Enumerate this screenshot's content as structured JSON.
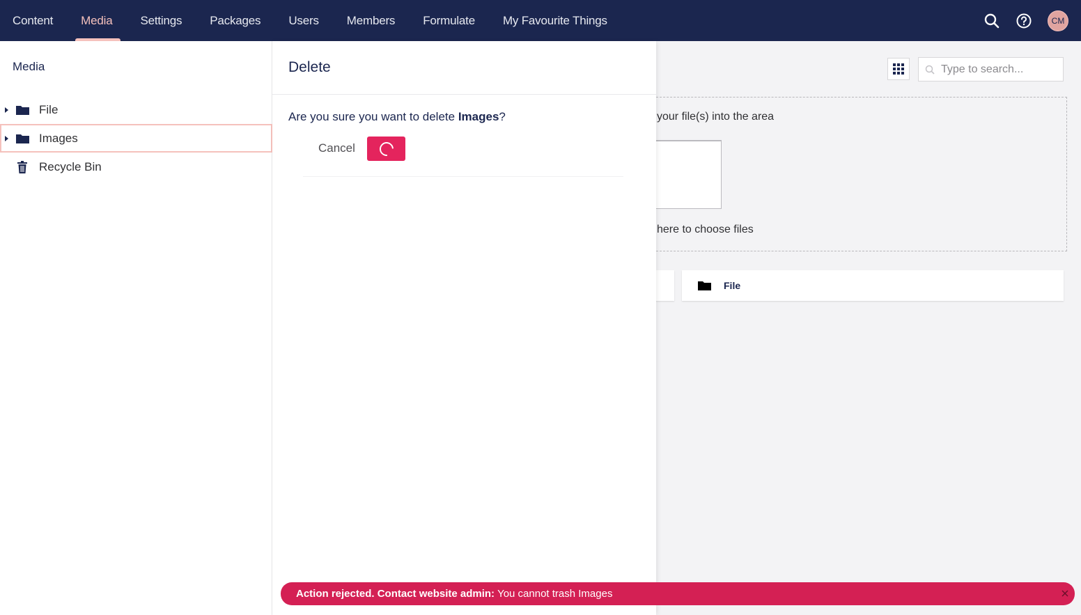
{
  "nav": {
    "items": [
      {
        "label": "Content",
        "active": false
      },
      {
        "label": "Media",
        "active": true
      },
      {
        "label": "Settings",
        "active": false
      },
      {
        "label": "Packages",
        "active": false
      },
      {
        "label": "Users",
        "active": false
      },
      {
        "label": "Members",
        "active": false
      },
      {
        "label": "Formulate",
        "active": false
      },
      {
        "label": "My Favourite Things",
        "active": false
      }
    ],
    "tools": {
      "search_icon": "search-icon",
      "help_icon": "help-icon",
      "avatar_initials": "CM"
    }
  },
  "tree": {
    "title": "Media",
    "items": [
      {
        "label": "File",
        "icon": "folder-icon",
        "selected": false
      },
      {
        "label": "Images",
        "icon": "folder-icon",
        "selected": true
      },
      {
        "label": "Recycle Bin",
        "icon": "trash-icon",
        "selected": false
      }
    ]
  },
  "dialog": {
    "title": "Delete",
    "message_prefix": "Are you sure you want to delete ",
    "message_item": "Images",
    "message_suffix": "?",
    "cancel_label": "Cancel",
    "confirm_state": "loading"
  },
  "main": {
    "search_placeholder": "Type to search...",
    "drop_text_1": "your file(s) into the area",
    "drop_text_2": "here to choose files",
    "card_label": "File"
  },
  "toast": {
    "title": "Action rejected. Contact website admin:",
    "message": "You cannot trash Images"
  },
  "colors": {
    "topbar": "#1b264f",
    "accent_active": "#f5c1bc",
    "danger": "#e4245d",
    "toast": "#d42054"
  }
}
